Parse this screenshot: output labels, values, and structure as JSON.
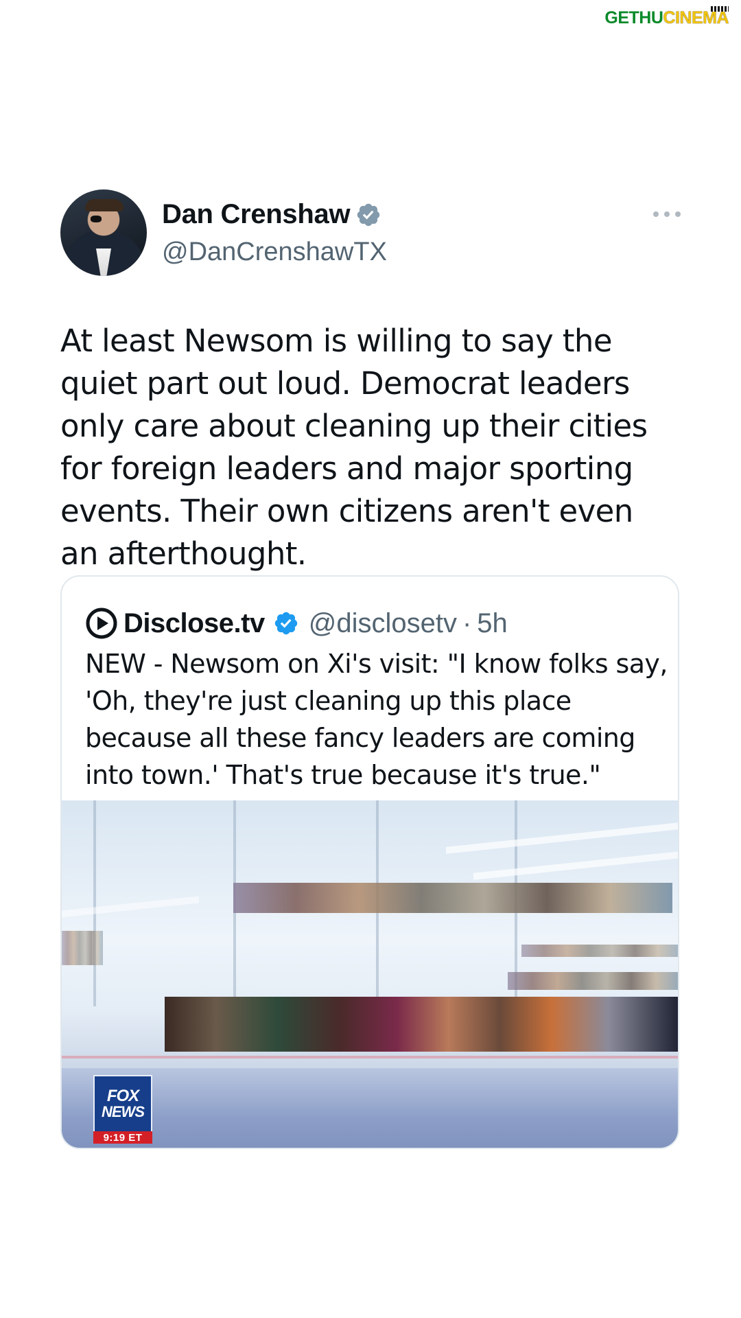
{
  "watermark": {
    "part1": "GETHU",
    "part2": "CINEMA"
  },
  "author": {
    "display_name": "Dan Crenshaw",
    "handle": "@DanCrenshawTX",
    "verified_icon": "verified-badge-icon",
    "avatar_icon": "avatar"
  },
  "tweet": {
    "text": "At least Newsom is willing to say the quiet part out loud. Democrat leaders only care about cleaning up their cities for foreign leaders and major sporting events. Their own citizens aren't even an afterthought."
  },
  "quote": {
    "name": "Disclose.tv",
    "handle": "@disclosetv",
    "separator": "·",
    "time": "5h",
    "text": "NEW - Newsom on Xi's visit: \"I know folks say, 'Oh, they're just cleaning up this place because all these fancy leaders are coming into town.' That's true because it's true.\"",
    "media": {
      "logo_line1": "FOX",
      "logo_line2": "NEWS",
      "timestamp": "9:19 ET"
    }
  },
  "colors": {
    "verified_grey": "#829aab",
    "handle_grey": "#536471",
    "quote_badge_blue": "#1d9bf0"
  }
}
